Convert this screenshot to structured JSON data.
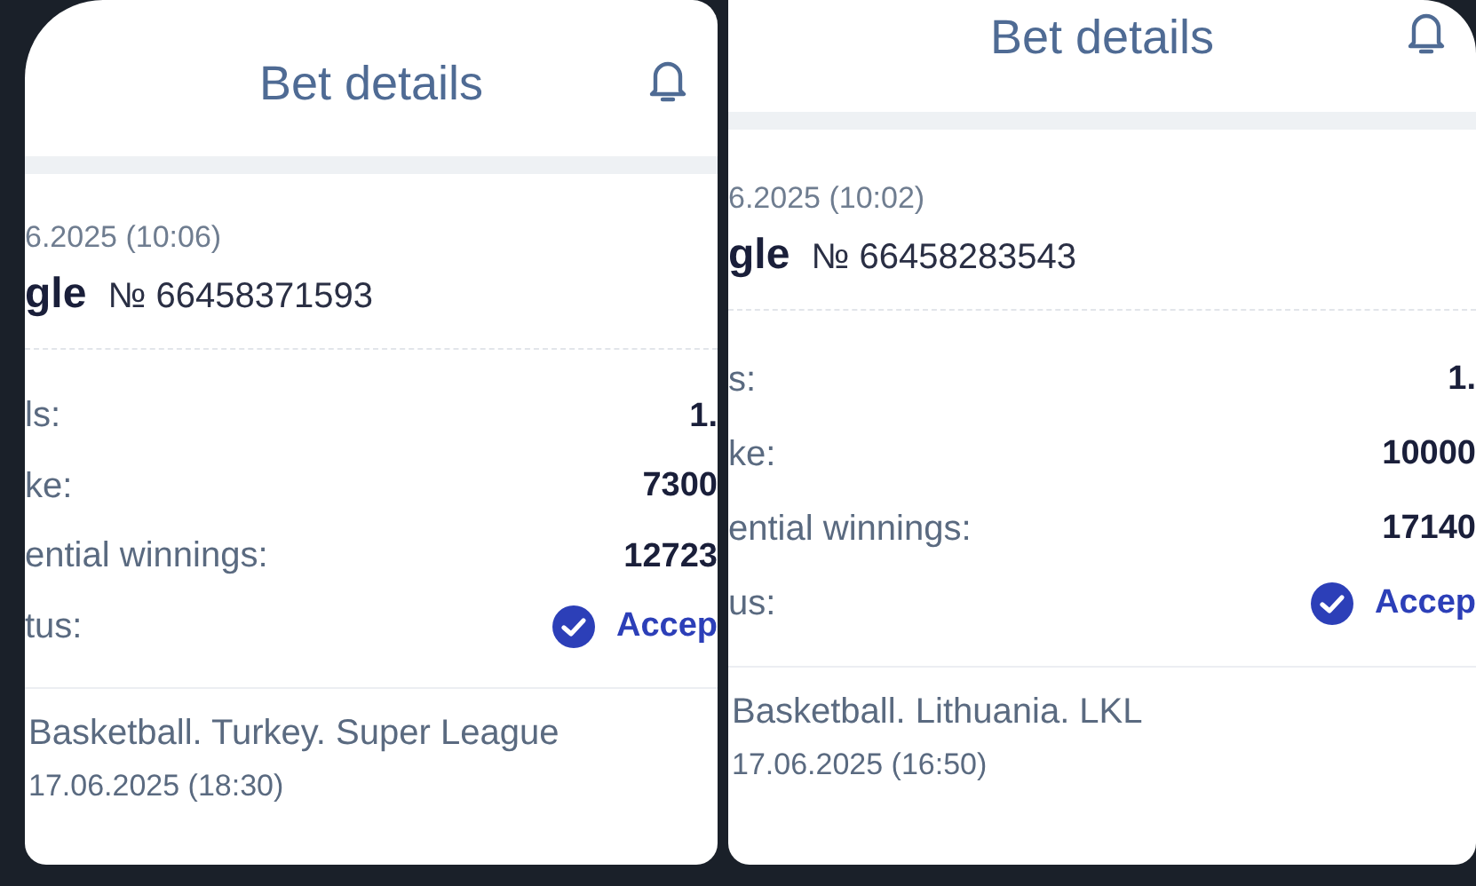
{
  "panels": [
    {
      "title": "Bet details",
      "datetime": "6.2025 (10:06)",
      "bet_type": "gle",
      "bet_number": "№ 66458371593",
      "rows": [
        {
          "kind": "plain",
          "label": "ls:",
          "value": "1."
        },
        {
          "kind": "plain",
          "label": "ke:",
          "value": "7300"
        },
        {
          "kind": "plain",
          "label": "ential winnings:",
          "value": "12723"
        },
        {
          "kind": "status",
          "label": "tus:",
          "value": "Accep"
        }
      ],
      "league": "Basketball. Turkey. Super League",
      "match_date": "17.06.2025 (18:30)"
    },
    {
      "title": "Bet details",
      "datetime": "6.2025 (10:02)",
      "bet_type": "gle",
      "bet_number": "№ 66458283543",
      "rows": [
        {
          "kind": "plain",
          "label": "s:",
          "value": "1."
        },
        {
          "kind": "plain",
          "label": "ke:",
          "value": "10000"
        },
        {
          "kind": "plain",
          "label": "ential winnings:",
          "value": "17140"
        },
        {
          "kind": "status",
          "label": "us:",
          "value": "Accep"
        }
      ],
      "league": "Basketball. Lithuania. LKL",
      "match_date": "17.06.2025 (16:50)"
    }
  ]
}
